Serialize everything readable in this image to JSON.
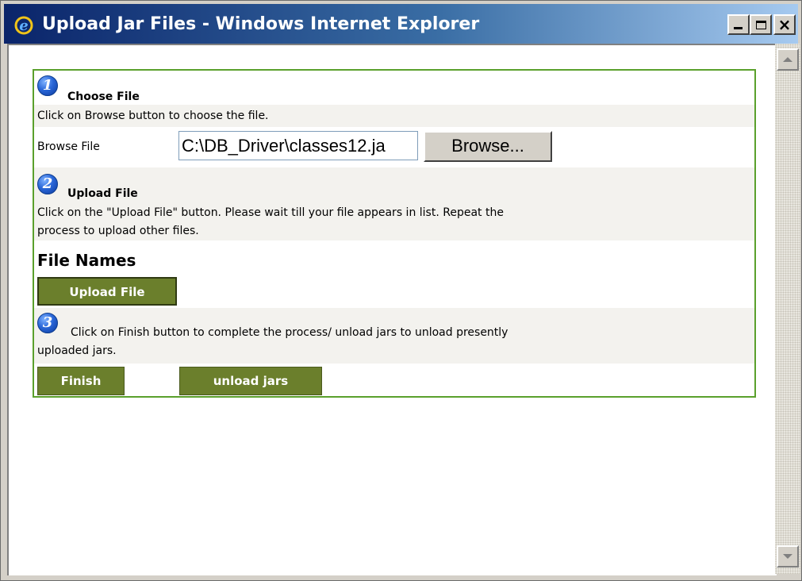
{
  "window": {
    "title": "Upload Jar Files - Windows Internet Explorer",
    "icon": "ie-icon",
    "controls": {
      "minimize": "minimize",
      "maximize": "maximize",
      "close": "×"
    }
  },
  "steps": {
    "step1": {
      "number": "1",
      "heading": "Choose File",
      "instruction": "Click on Browse button to choose the file.",
      "browse_label": "Browse File",
      "file_value": "C:\\DB_Driver\\classes12.ja",
      "browse_button": "Browse..."
    },
    "step2": {
      "number": "2",
      "heading": "Upload File",
      "instruction_line1": "Click on the \"Upload File\" button. Please wait till your file appears in list. Repeat the",
      "instruction_line2": "process to upload other files.",
      "file_names_heading": "File Names",
      "upload_button": "Upload File"
    },
    "step3": {
      "number": "3",
      "instruction_line1": "Click on Finish button to complete the process/ unload jars to unload presently",
      "instruction_line2": "uploaded jars.",
      "finish_button": "Finish",
      "unload_button": "unload jars"
    }
  },
  "colors": {
    "titlebar_start": "#0a246a",
    "titlebar_end": "#a6caf0",
    "panel_border": "#5aa02c",
    "button_olive": "#6b7f2c"
  }
}
